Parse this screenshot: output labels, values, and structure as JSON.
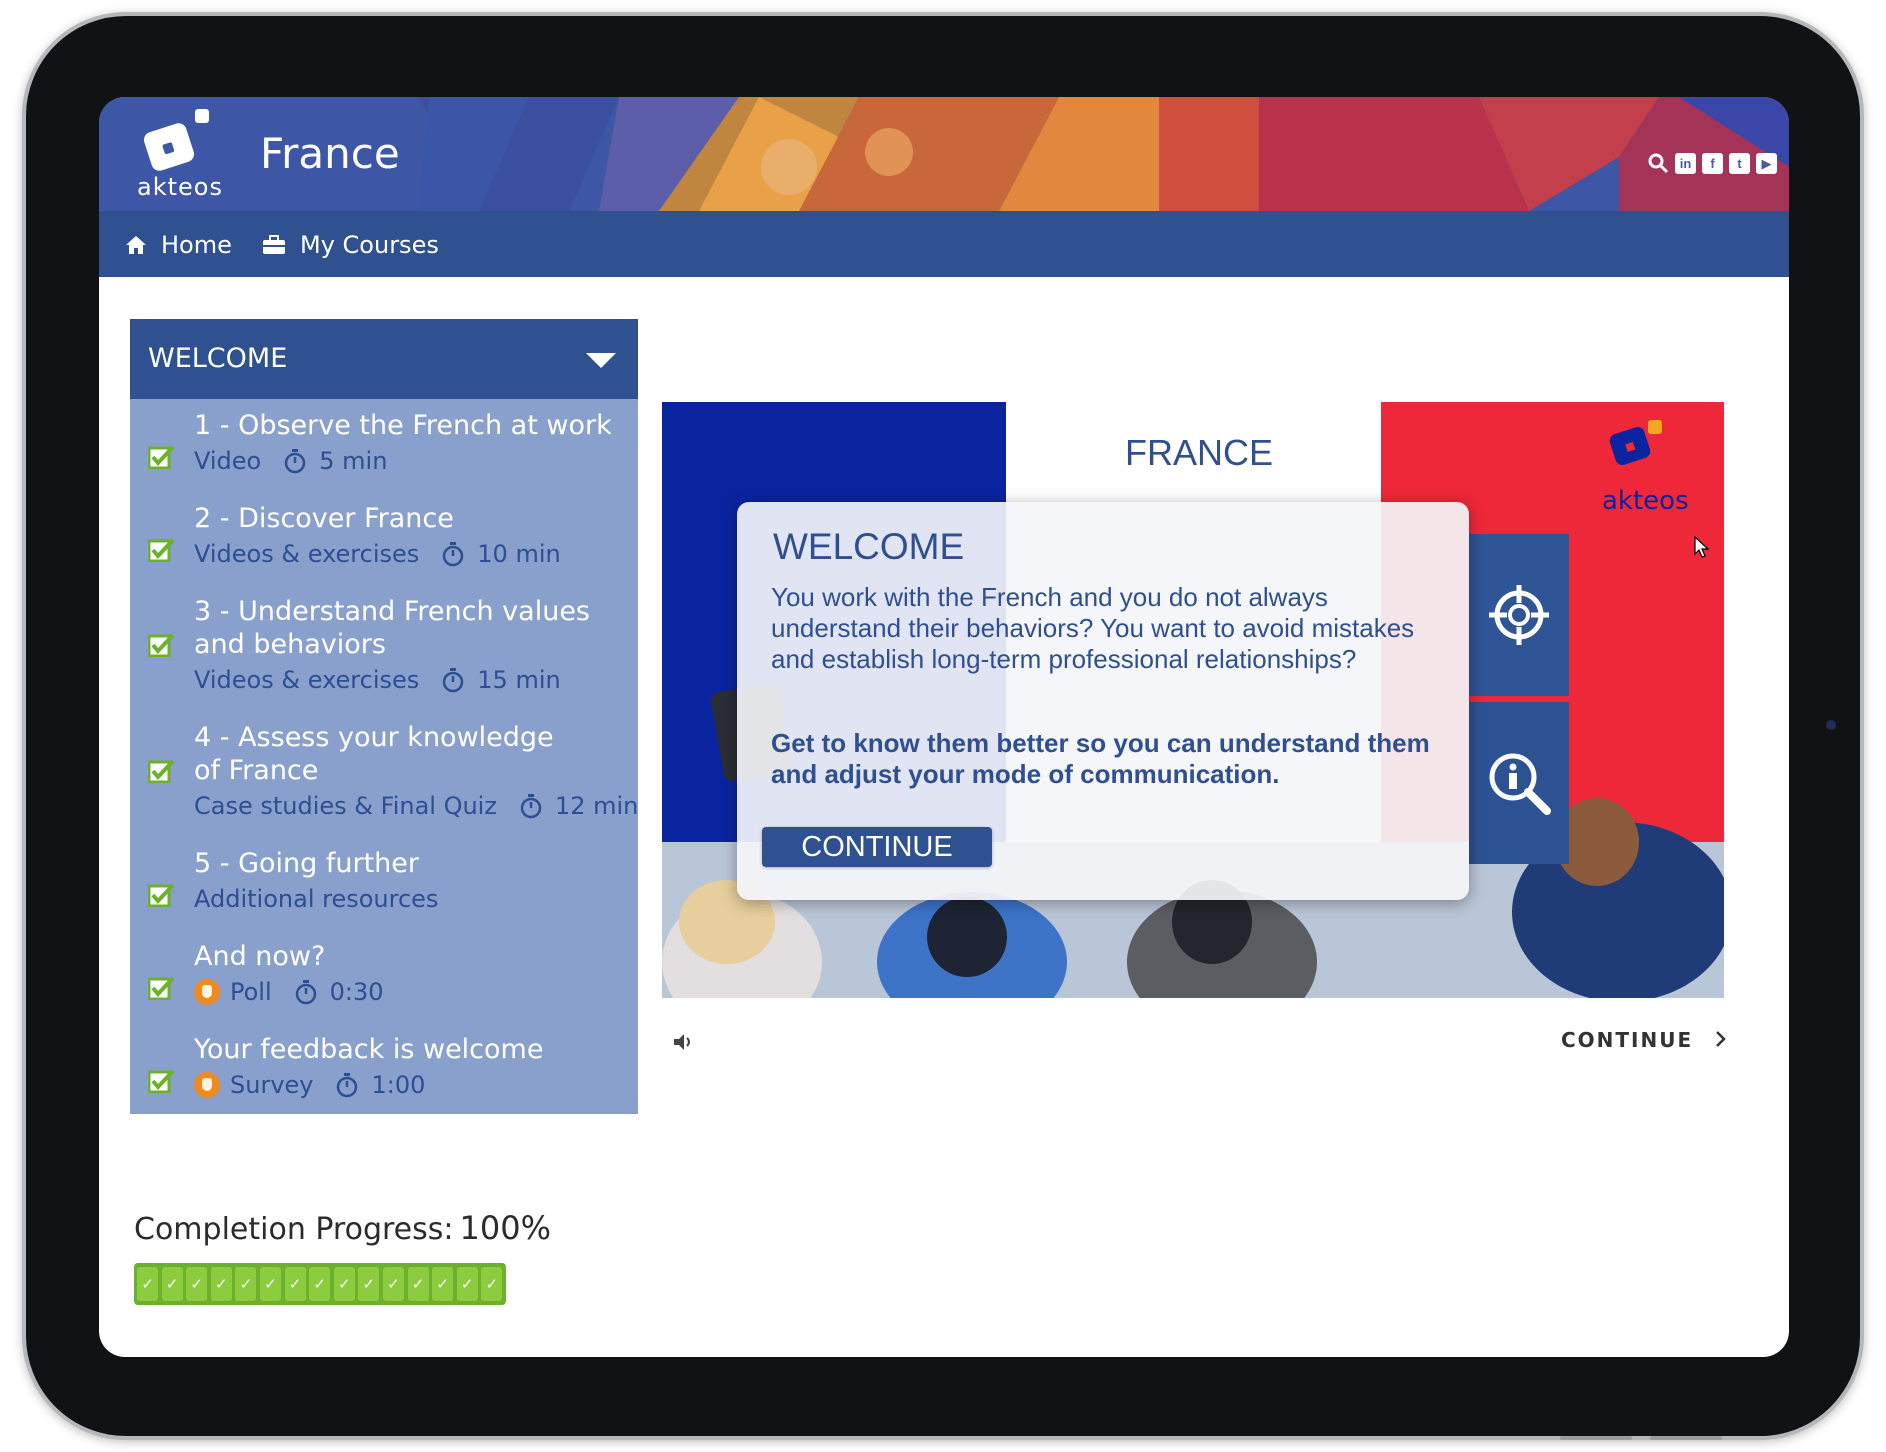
{
  "header": {
    "logo_text": "akteos",
    "site_title": "France",
    "social_icons": [
      "search-icon",
      "linkedin-icon",
      "facebook-icon",
      "twitter-icon",
      "youtube-icon"
    ]
  },
  "nav": {
    "home": "Home",
    "courses": "My Courses"
  },
  "sidebar": {
    "section_title": "WELCOME",
    "items": [
      {
        "title": "1 - Observe the French at work",
        "type": "Video",
        "duration": "5 min"
      },
      {
        "title": "2 - Discover France",
        "type": "Videos & exercises",
        "duration": "10 min"
      },
      {
        "title": "3 - Understand French values and behaviors",
        "type": "Videos & exercises",
        "duration": "15 min"
      },
      {
        "title": "4 - Assess your knowledge of France",
        "type": "Case studies & Final Quiz",
        "duration": "12 min"
      },
      {
        "title": "5 - Going further",
        "type": "Additional resources",
        "duration": ""
      },
      {
        "title": "And now?",
        "type": "Poll",
        "duration": "0:30"
      },
      {
        "title": "Your feedback is welcome",
        "type": "Survey",
        "duration": "1:00"
      }
    ]
  },
  "progress": {
    "label": "Completion Progress:",
    "value": "100%",
    "fraction": 1.0,
    "segments": 15
  },
  "slide": {
    "title": "FRANCE",
    "logo_text": "akteos",
    "modal": {
      "heading": "WELCOME",
      "paragraph": "You work with the French and you do not always understand their behaviors? You want to avoid mistakes and establish long-term professional relationships?",
      "bold": "Get to know them better so you can understand them and adjust your mode of communication.",
      "button": "CONTINUE"
    }
  },
  "player": {
    "continue_label": "CONTINUE"
  },
  "colors": {
    "nav_blue": "#30518f",
    "sidebar_bg": "#8aa0cc",
    "flag_blue": "#0a24a0",
    "flag_red": "#ee2838",
    "check_green": "#6cb02d"
  }
}
